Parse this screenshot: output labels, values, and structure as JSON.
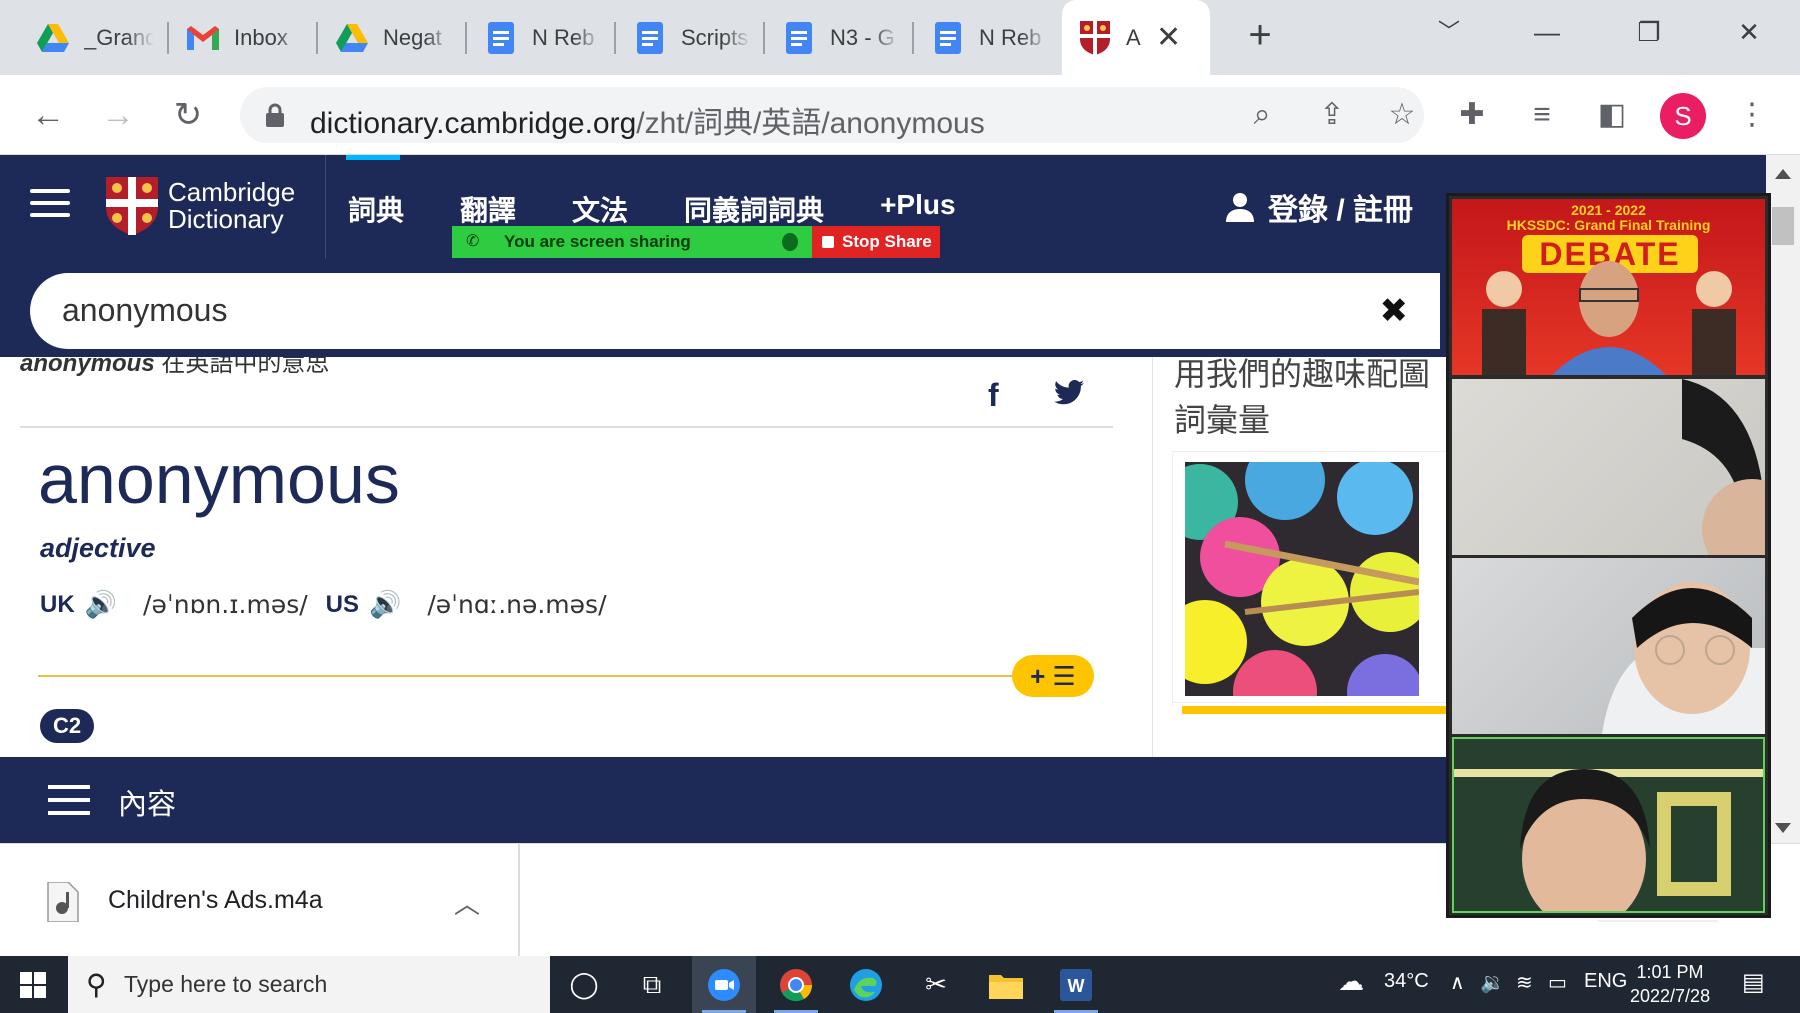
{
  "browser": {
    "tabs": [
      {
        "label": "_Grand",
        "icon": "google-drive-icon"
      },
      {
        "label": "Inbox",
        "icon": "gmail-icon"
      },
      {
        "label": "Negat",
        "icon": "google-drive-icon"
      },
      {
        "label": "N Reb",
        "icon": "google-docs-icon"
      },
      {
        "label": "Scripts",
        "icon": "google-docs-icon"
      },
      {
        "label": "N3 - G",
        "icon": "google-docs-icon"
      },
      {
        "label": "N Reb",
        "icon": "google-docs-icon"
      },
      {
        "label": "A",
        "icon": "cambridge-shield-icon",
        "active": true
      }
    ],
    "url_host": "dictionary.cambridge.org",
    "url_path": "/zht/詞典/英語/anonymous",
    "profile_initial": "S"
  },
  "header": {
    "logo_line1": "Cambridge",
    "logo_line2": "Dictionary",
    "nav": [
      "詞典",
      "翻譯",
      "文法",
      "同義詞詞典",
      "+Plus"
    ],
    "login": "登錄 / 註冊"
  },
  "share_banner": {
    "status": "You are screen sharing",
    "stop": "Stop Share"
  },
  "search": {
    "value": "anonymous"
  },
  "entry": {
    "subtitle_word": "anonymous",
    "subtitle_rest": "在英語中的意思",
    "headword": "anonymous",
    "pos": "adjective",
    "uk_label": "UK",
    "uk_ipa": "/əˈnɒn.ɪ.məs/",
    "us_label": "US",
    "us_ipa": "/əˈnɑː.nə.məs/",
    "wordlist_button": "+ ☰",
    "level": "C2"
  },
  "sidebar": {
    "promo_line1": "用我們的趣味配圖",
    "promo_line2": "詞彙量"
  },
  "contents_bar": {
    "label": "內容"
  },
  "downloads": {
    "file_name": "Children's Ads.m4a"
  },
  "video_panel": {
    "tile1_title": "2021 - 2022\nHKSSDC: Grand Final Training",
    "tile1_banner": "DEBATE"
  },
  "taskbar": {
    "search_placeholder": "Type here to search",
    "weather": "34°C",
    "lang": "ENG",
    "time": "1:01 PM",
    "date": "2022/7/28"
  },
  "colors": {
    "cambridge_navy": "#1d2a57",
    "cambridge_yellow": "#fec400",
    "share_green": "#2ecc40",
    "share_red": "#e02323"
  }
}
